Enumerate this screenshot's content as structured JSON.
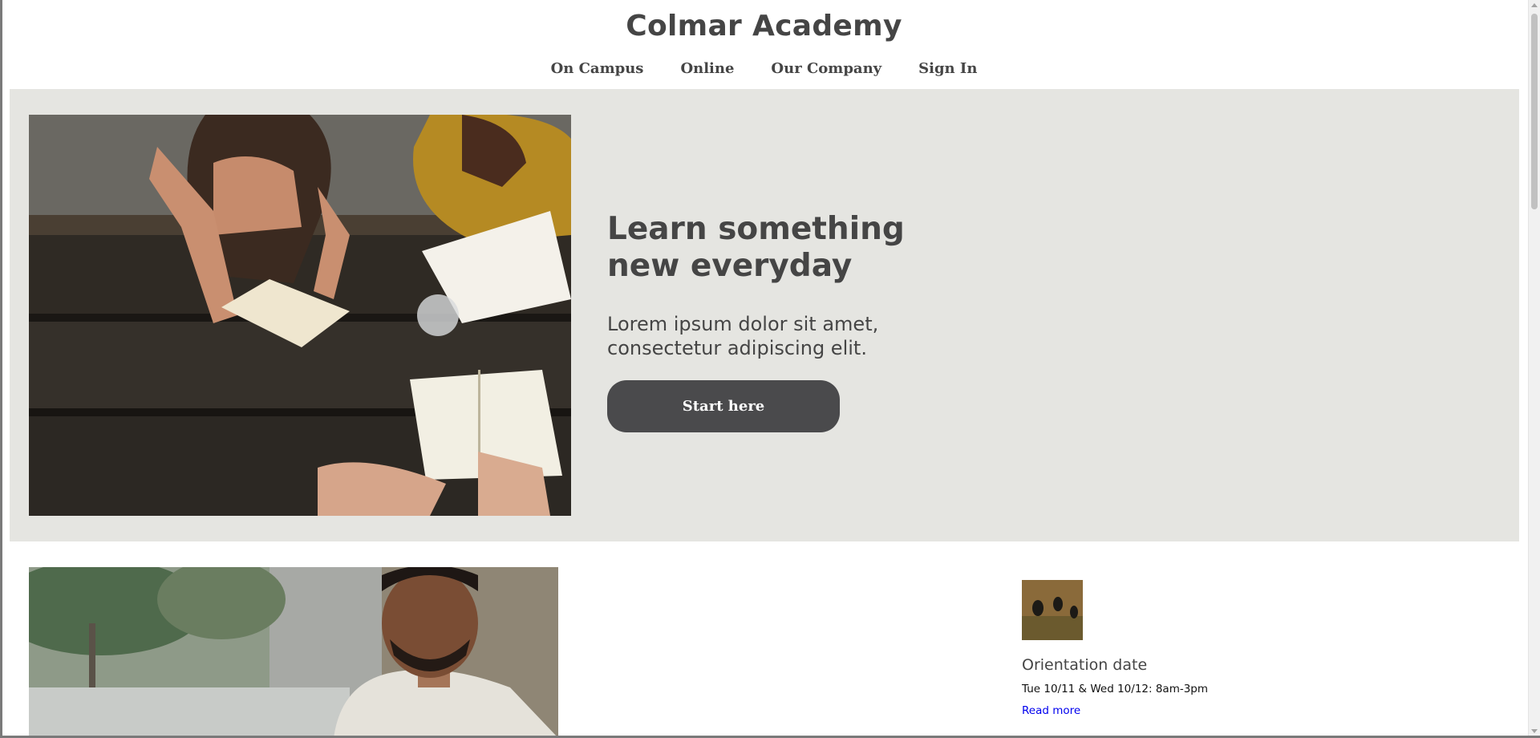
{
  "header": {
    "title": "Colmar Academy",
    "nav": [
      "On Campus",
      "Online",
      "Our Company",
      "Sign In"
    ]
  },
  "hero": {
    "heading": "Learn something new everyday",
    "subtitle": "Lorem ipsum dolor sit amet, consectetur adipiscing elit.",
    "button_label": "Start here",
    "photo": "students-reading-at-picnic-table"
  },
  "feature": {
    "photo": "smiling-man-outdoors"
  },
  "event": {
    "thumbnail": "birds-on-field",
    "title": "Orientation date",
    "date": "Tue 10/11 & Wed 10/12: 8am-3pm",
    "link_label": "Read more"
  },
  "colors": {
    "hero_background": "#e5e5e1",
    "button_background": "#4a4a4c",
    "text": "#454545",
    "link": "#0000ee"
  }
}
